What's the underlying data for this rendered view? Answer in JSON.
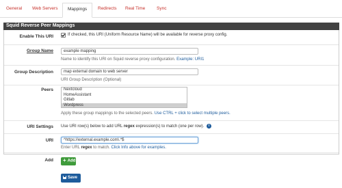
{
  "tabs": [
    {
      "label": "General"
    },
    {
      "label": "Web Servers"
    },
    {
      "label": "Mappings"
    },
    {
      "label": "Redirects"
    },
    {
      "label": "Real Time"
    },
    {
      "label": "Sync"
    }
  ],
  "panel": {
    "title": "Squid Reverse Peer Mappings"
  },
  "enable_uri": {
    "label": "Enable This URI",
    "checked": true,
    "text": "If checked, this URI (Uniform Resource Name) will be available for reverse proxy config."
  },
  "group_name": {
    "label": "Group Name",
    "value": "example mapping",
    "help": "Name to identify this URI on Squid reverse proxy configuration.",
    "help_link": "Example: URI1"
  },
  "group_description": {
    "label": "Group Description",
    "value": "map external domain to web server",
    "help": "URI Group Description (Optional)"
  },
  "peers": {
    "label": "Peers",
    "options": [
      "Nextcloud",
      "HomeAssistant",
      "Gitlab",
      "Wordpress"
    ],
    "selected": "Wordpress",
    "help": "Apply these group mappings to the selected peers.",
    "help_link": "Use CTRL + click to select multiple peers."
  },
  "uri_settings": {
    "label": "URI Settings",
    "help_pre": "Use URI row(s) below to add URL",
    "help_bold": "regex",
    "help_post": "expression(s) to match (one per row).",
    "icon": "info-circle-icon"
  },
  "uri": {
    "label": "URI",
    "value": "^https://external.example.com\\.*$",
    "help_pre": "Enter URL",
    "help_bold": "regex",
    "help_post": "to match.",
    "help_link": "Click Info above for examples."
  },
  "add": {
    "label": "Add",
    "button_label": "Add"
  },
  "save": {
    "button_label": "Save"
  },
  "colors": {
    "accent": "#c7302a",
    "header": "#424242",
    "link": "#1e5c9c",
    "add_button": "#3f9b3b",
    "save_button": "#1e5c9c"
  }
}
